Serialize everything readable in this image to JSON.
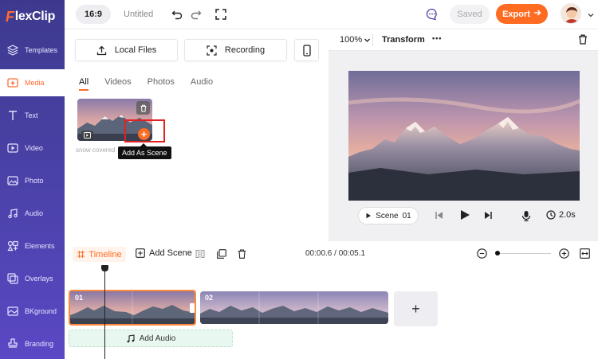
{
  "app": {
    "logo_text": "FlexClip",
    "logo_first_letter": "F",
    "logo_rest": "lexClip"
  },
  "sidebar": {
    "items": [
      {
        "label": "Templates",
        "icon": "layers-icon"
      },
      {
        "label": "Media",
        "icon": "media-upload-icon",
        "active": true
      },
      {
        "label": "Text",
        "icon": "text-icon"
      },
      {
        "label": "Video",
        "icon": "video-icon"
      },
      {
        "label": "Photo",
        "icon": "photo-icon"
      },
      {
        "label": "Audio",
        "icon": "music-icon"
      },
      {
        "label": "Elements",
        "icon": "elements-icon"
      },
      {
        "label": "Overlays",
        "icon": "overlays-icon"
      },
      {
        "label": "BKground",
        "icon": "background-icon"
      },
      {
        "label": "Branding",
        "icon": "branding-icon"
      }
    ]
  },
  "topbar": {
    "ratio": "16:9",
    "title": "Untitled",
    "saved_label": "Saved",
    "export_label": "Export"
  },
  "media": {
    "local_files_label": "Local Files",
    "recording_label": "Recording",
    "tabs": [
      "All",
      "Videos",
      "Photos",
      "Audio"
    ],
    "active_tab": "All",
    "item_caption": "snow covered",
    "tooltip": "Add As Scene"
  },
  "preview": {
    "zoom": "100%",
    "transform_label": "Transform",
    "more_label": "•••",
    "scene_label": "Scene",
    "scene_number": "01",
    "duration": "2.0s"
  },
  "timeline": {
    "tab_label": "Timeline",
    "add_scene_label": "Add Scene",
    "time_display": "00:00.6 / 00:05.1",
    "clips": [
      {
        "number": "01",
        "selected": true
      },
      {
        "number": "02",
        "selected": false
      }
    ],
    "add_audio_label": "Add Audio",
    "add_plus": "+"
  },
  "colors": {
    "accent": "#ff6b21",
    "sidebar_top": "#3d3a8e",
    "sidebar_bottom": "#5a48c4",
    "highlight_box": "#e12222"
  }
}
